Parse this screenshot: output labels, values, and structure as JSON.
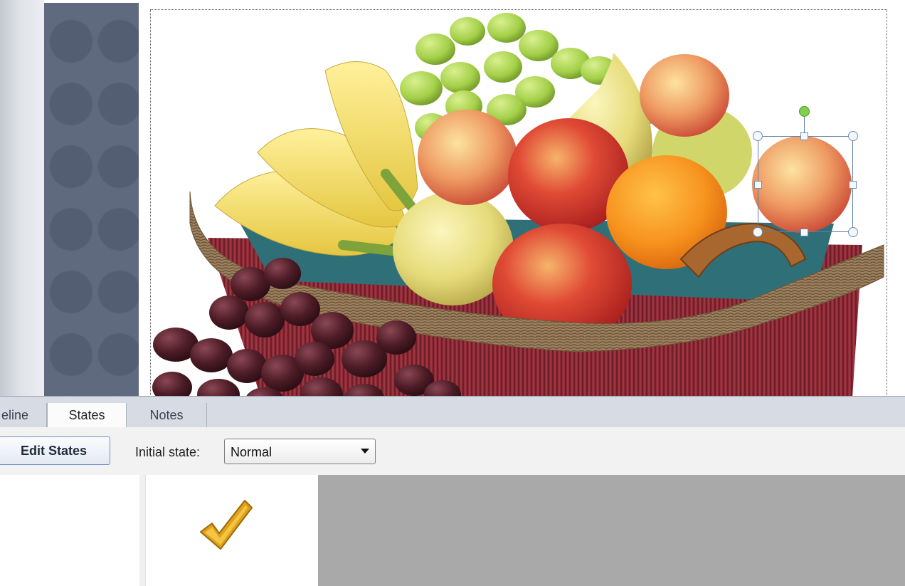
{
  "tabs": [
    {
      "label": "eline",
      "active": false
    },
    {
      "label": "States",
      "active": true
    },
    {
      "label": "Notes",
      "active": false
    }
  ],
  "toolbar": {
    "edit_states_label": "Edit States",
    "initial_state_label": "Initial state:",
    "initial_state_value": "Normal"
  },
  "icons": {
    "state_thumbnail": "checkmark-icon",
    "rotate": "rotate-handle",
    "dropdown": "chevron-down-icon"
  },
  "colors": {
    "checkmark": "#e0a21a",
    "selection": "#5a7fa8",
    "rotate_handle": "#7ed04d",
    "side_panel": "#5f6a7e",
    "states_background": "#a9a9a9"
  }
}
